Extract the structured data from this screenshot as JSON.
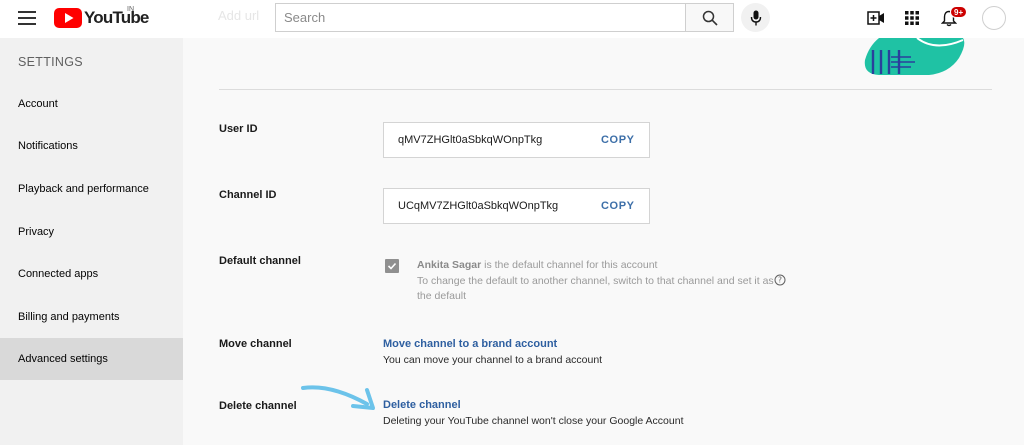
{
  "header": {
    "logo_text": "YouTube",
    "logo_country": "IN",
    "page_title_faded": "Add url",
    "search_placeholder": "Search",
    "notification_count": "9+",
    "brand_color": "#ff0000"
  },
  "sidebar": {
    "heading": "SETTINGS",
    "items": [
      {
        "label": "Account"
      },
      {
        "label": "Notifications"
      },
      {
        "label": "Playback and performance"
      },
      {
        "label": "Privacy"
      },
      {
        "label": "Connected apps"
      },
      {
        "label": "Billing and payments"
      },
      {
        "label": "Advanced settings",
        "active": true
      }
    ]
  },
  "main": {
    "user_id": {
      "label": "User ID",
      "value": "qMV7ZHGlt0aSbkqWOnpTkg",
      "copy_label": "COPY"
    },
    "channel_id": {
      "label": "Channel ID",
      "value": "UCqMV7ZHGlt0aSbkqWOnpTkg",
      "copy_label": "COPY"
    },
    "default_channel": {
      "label": "Default channel",
      "checked": true,
      "channel_name": "Ankita Sagar",
      "line1_rest": " is the default channel for this account",
      "line2": "To change the default to another channel, switch to that channel and set it as the default"
    },
    "move_channel": {
      "label": "Move channel",
      "link": "Move channel to a brand account",
      "description": "You can move your channel to a brand account"
    },
    "delete_channel": {
      "label": "Delete channel",
      "link": "Delete channel",
      "description": "Deleting your YouTube channel won't close your Google Account"
    }
  }
}
